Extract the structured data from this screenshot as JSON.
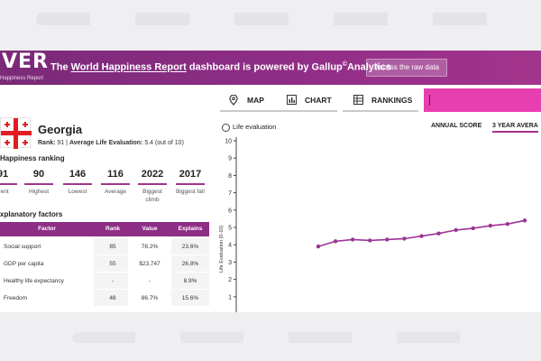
{
  "banner": {
    "logo": "VER",
    "logo_sub": "Happiness Report",
    "text_prefix": "The ",
    "link": "World Happiness Report",
    "text_mid": " dashboard is powered by Gallup",
    "text_sup": "©",
    "text_suffix": "Analytics",
    "raw_button": "Access the raw data"
  },
  "country": {
    "name": "Georgia",
    "rank_label": "Rank:",
    "rank_value": "91",
    "sep": "|",
    "avg_label": "Average Life Evaluation:",
    "avg_value": "5.4 (out of 10)"
  },
  "ranking": {
    "title": "Happiness ranking",
    "stats": [
      {
        "num": "91",
        "label": "rrent"
      },
      {
        "num": "90",
        "label": "Highest"
      },
      {
        "num": "146",
        "label": "Lowest"
      },
      {
        "num": "116",
        "label": "Average"
      },
      {
        "num": "2022",
        "label": "Biggest climb"
      },
      {
        "num": "2017",
        "label": "Biggest fall"
      }
    ]
  },
  "factors": {
    "title": "xplanatory factors",
    "headers": {
      "factor": "Factor",
      "rank": "Rank",
      "value": "Value",
      "explains": "Explains"
    },
    "rows": [
      {
        "factor": "Social support",
        "rank": "85",
        "value": "78.2%",
        "explains": "23.6%"
      },
      {
        "factor": "GDP per capita",
        "rank": "55",
        "value": "$23,747",
        "explains": "26.8%"
      },
      {
        "factor": "Healthy life expectancy",
        "rank": "-",
        "value": "-",
        "explains": "8.9%"
      },
      {
        "factor": "Freedom",
        "rank": "48",
        "value": "86.7%",
        "explains": "15.6%"
      }
    ]
  },
  "tabs": [
    {
      "label": "MAP",
      "icon": "map-pin-icon"
    },
    {
      "label": "CHART",
      "icon": "bar-chart-icon"
    },
    {
      "label": "RANKINGS",
      "icon": "list-icon"
    }
  ],
  "chart": {
    "title": "Life evaluation",
    "ylabel": "Life Evaluation (0-10)",
    "toggle_annual": "ANNUAL SCORE",
    "toggle_3yr": "3 YEAR AVERA"
  },
  "chart_data": {
    "type": "line",
    "title": "Life evaluation",
    "ylabel": "Life Evaluation (0-10)",
    "ylim": [
      0,
      10
    ],
    "yticks": [
      1,
      2,
      3,
      4,
      5,
      6,
      7,
      8,
      9,
      10
    ],
    "grid": false,
    "series": [
      {
        "values": [
          3.9,
          4.2,
          4.3,
          4.25,
          4.3,
          4.35,
          4.5,
          4.65,
          4.85,
          4.95,
          5.1,
          5.2,
          5.4
        ]
      }
    ],
    "color": "#9b3592"
  },
  "colors": {
    "brand": "#8e2d86",
    "accent": "#e83fb0",
    "flag_red": "#e31b23"
  }
}
